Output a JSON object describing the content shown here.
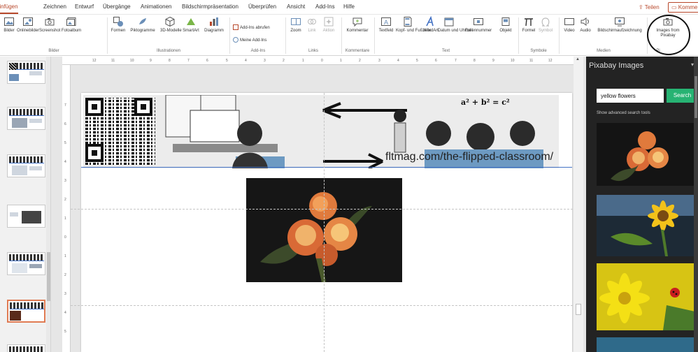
{
  "tabs": {
    "items": [
      "Einfügen",
      "Zeichnen",
      "Entwurf",
      "Übergänge",
      "Animationen",
      "Bildschirmpräsentation",
      "Überprüfen",
      "Ansicht",
      "Add-Ins",
      "Hilfe"
    ],
    "active": "Einfügen",
    "share_label": "Teilen",
    "comment_label": "Komme"
  },
  "ribbon": {
    "bilder": {
      "buttons": [
        "Bilder",
        "Onlinebilder",
        "Screenshot",
        "Fotoalbum"
      ],
      "group_label": "Bilder"
    },
    "illustrationen": {
      "buttons": [
        "Formen",
        "Piktogramme",
        "3D-Modelle",
        "SmartArt",
        "Diagramm"
      ],
      "group_label": "Illustrationen"
    },
    "add_ins": {
      "get_label": "Add-Ins abrufen",
      "my_label": "Meine Add-Ins",
      "group_label": "Add-Ins"
    },
    "links": {
      "buttons": [
        "Zoom",
        "Link",
        "Aktion"
      ],
      "group_label": "Links"
    },
    "kommentare": {
      "button": "Kommentar",
      "group_label": "Kommentare"
    },
    "text": {
      "buttons": [
        "Textfeld",
        "Kopf- und Fußzeile",
        "WordArt",
        "Datum und Uhrzeit",
        "Foliennummer",
        "Objekt"
      ],
      "group_label": "Text"
    },
    "symbole": {
      "buttons": [
        "Formel",
        "Symbol"
      ],
      "group_label": "Symbole"
    },
    "medien": {
      "buttons": [
        "Video",
        "Audio",
        "Bildschirmaufzeichnung"
      ],
      "group_label": "Medien"
    },
    "pixabay": {
      "button": "Images from Pixabay",
      "group_label": "Pi"
    }
  },
  "ruler": {
    "top_ticks": [
      "12",
      "11",
      "10",
      "9",
      "8",
      "7",
      "6",
      "5",
      "4",
      "3",
      "2",
      "1",
      "0",
      "1",
      "2",
      "3",
      "4",
      "5",
      "6",
      "7",
      "8",
      "9",
      "10",
      "11",
      "12"
    ],
    "left_ticks": [
      "7",
      "6",
      "5",
      "4",
      "3",
      "2",
      "1",
      "0",
      "1",
      "2",
      "3",
      "4",
      "5"
    ]
  },
  "slide": {
    "formula": "a² + b² = c²",
    "url_text": "fltmag.com/the-flipped-classroom/"
  },
  "pane": {
    "title": "Pixabay Images",
    "search_value": "yellow flowers",
    "search_button": "Search",
    "advanced_link": "Show advanced search tools"
  },
  "colors": {
    "accent": "#b7472a",
    "search_button": "#27b373",
    "pane_bg": "#232323"
  }
}
